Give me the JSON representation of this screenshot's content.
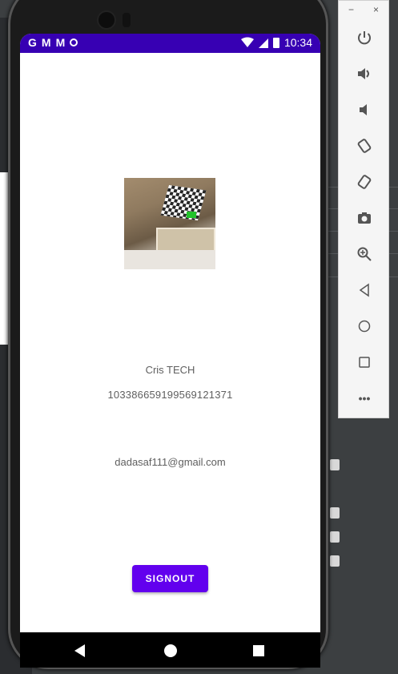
{
  "status_bar": {
    "notification_icons": [
      "G",
      "M",
      "M"
    ],
    "time": "10:34"
  },
  "profile": {
    "name": "Cris TECH",
    "id": "103386659199569121371",
    "email": "dadasaf111@gmail.com"
  },
  "actions": {
    "signout_label": "SIGNOUT"
  },
  "emulator_toolbar": {
    "window_controls": [
      "−",
      "×"
    ],
    "items": [
      "power-icon",
      "volume-up-icon",
      "volume-down-icon",
      "rotate-left-icon",
      "rotate-right-icon",
      "camera-icon",
      "zoom-icon",
      "back-icon",
      "home-icon",
      "overview-icon",
      "more-icon"
    ],
    "more_label": "•••"
  },
  "colors": {
    "status_bar": "#3700b3",
    "button": "#6200ee",
    "nav_bar": "#000000"
  }
}
